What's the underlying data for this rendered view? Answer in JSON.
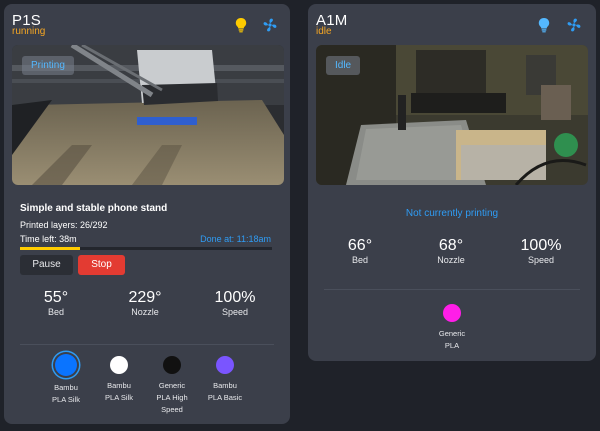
{
  "printers": [
    {
      "name": "P1S",
      "state": "running",
      "camera_badge": "Printing",
      "job": {
        "title": "Simple and stable phone stand",
        "layers": "Printed layers: 26/292",
        "time_left": "Time left: 38m",
        "done_at": "Done at: 11:18am",
        "progress": 0.24
      },
      "buttons": {
        "pause": "Pause",
        "stop": "Stop"
      },
      "stats": [
        {
          "value": "55°",
          "label": "Bed"
        },
        {
          "value": "229°",
          "label": "Nozzle"
        },
        {
          "value": "100%",
          "label": "Speed"
        }
      ],
      "spools": [
        {
          "brand": "Bambu",
          "material": "PLA Silk",
          "color": "#0a74ff",
          "active": true
        },
        {
          "brand": "Bambu",
          "material": "PLA Silk",
          "color": "#ffffff",
          "active": false
        },
        {
          "brand": "Generic",
          "material": "PLA High",
          "material2": "Speed",
          "color": "#111111",
          "active": false
        },
        {
          "brand": "Bambu",
          "material": "PLA Basic",
          "color": "#7a55ff",
          "active": false
        }
      ]
    },
    {
      "name": "A1M",
      "state": "idle",
      "camera_badge": "Idle",
      "status_text": "Not currently printing",
      "stats": [
        {
          "value": "66°",
          "label": "Bed"
        },
        {
          "value": "68°",
          "label": "Nozzle"
        },
        {
          "value": "100%",
          "label": "Speed"
        }
      ],
      "spools": [
        {
          "brand": "Generic",
          "material": "PLA",
          "color": "#ff1ee8",
          "active": false
        }
      ]
    }
  ],
  "icons": {
    "light": "lightbulb-icon",
    "fan": "fan-icon"
  },
  "colors": {
    "background": "#1f2229",
    "card": "#3b3f4a",
    "accent_blue": "#2f9cf4",
    "state_orange": "#f5a623",
    "light_on": "#ffcc00",
    "light_off": "#54b8ff",
    "stop_red": "#e33b32",
    "progress": "#ffcc00"
  }
}
